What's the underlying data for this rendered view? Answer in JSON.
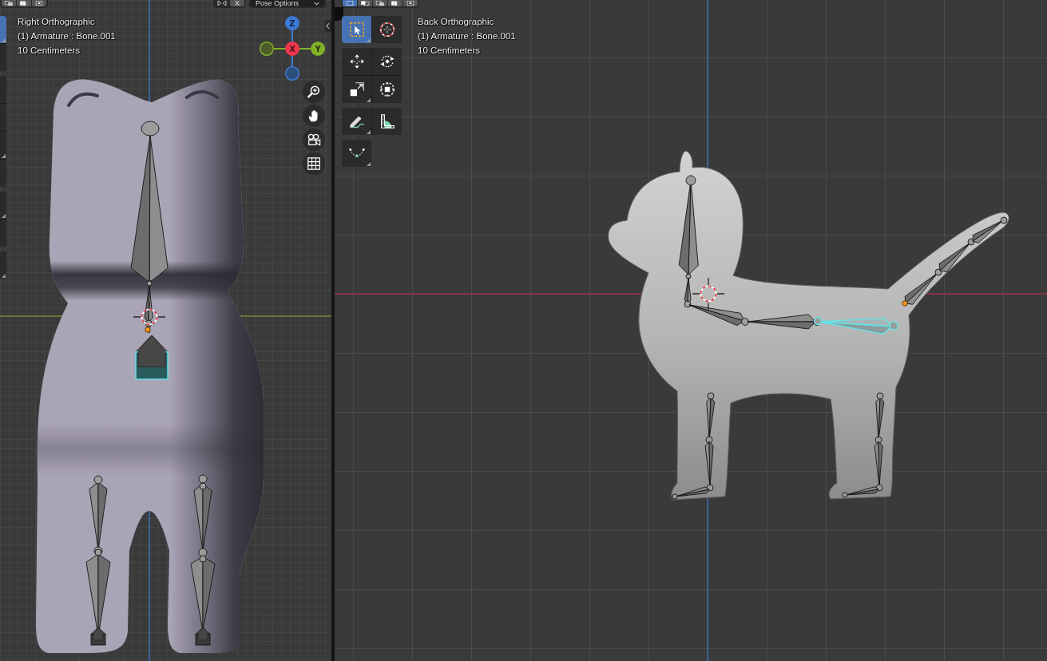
{
  "viewports": [
    {
      "header": {
        "select_modes": [
          {
            "kind": "subtract",
            "selected": false
          },
          {
            "kind": "difference",
            "selected": false
          },
          {
            "kind": "intersect",
            "selected": false
          }
        ],
        "symmetry": {
          "label": "X",
          "on": false
        },
        "options": "Pose Options"
      },
      "toolbar": {
        "groups": [
          [
            {
              "selected": true,
              "has_variants": true
            },
            {
              "selected": false,
              "has_variants": false
            }
          ],
          [
            {
              "selected": false,
              "has_variants": false
            },
            {
              "selected": false,
              "has_variants": false
            },
            {
              "selected": false,
              "has_variants": true
            },
            {
              "selected": false,
              "has_variants": false
            }
          ],
          [
            {
              "selected": false,
              "has_variants": true
            },
            {
              "selected": false,
              "has_variants": false
            }
          ],
          [
            {
              "selected": false,
              "has_variants": true
            }
          ]
        ]
      },
      "info": {
        "view": "Right Orthographic",
        "object": "(1) Armature : Bone.001",
        "scale": "10 Centimeters"
      },
      "gizmo": {
        "axes": [
          {
            "label": "Z"
          },
          {
            "label": "X"
          },
          {
            "label": "Y"
          }
        ]
      },
      "navigation": [
        {
          "kind": "zoom"
        },
        {
          "kind": "pan"
        },
        {
          "kind": "camera"
        },
        {
          "kind": "ortho"
        }
      ],
      "scene": {
        "kind": "front",
        "bones": [
          {
            "selected": false
          },
          {
            "selected": false
          },
          {
            "selected": true
          },
          {
            "selected": false
          },
          {
            "selected": false
          },
          {
            "selected": false
          },
          {
            "selected": false
          },
          {
            "selected": false
          },
          {
            "selected": false
          }
        ]
      }
    },
    {
      "header": {
        "select_modes": [
          {
            "kind": "new",
            "selected": true
          },
          {
            "kind": "extend",
            "selected": false
          },
          {
            "kind": "subtract",
            "selected": false
          },
          {
            "kind": "difference",
            "selected": false
          },
          {
            "kind": "intersect",
            "selected": false
          }
        ]
      },
      "toolbar": {
        "groups": [
          [
            {
              "kind": "select_box",
              "selected": true,
              "has_variants": true
            },
            {
              "kind": "cursor",
              "selected": false,
              "has_variants": false
            }
          ],
          [
            {
              "kind": "move",
              "selected": false,
              "has_variants": false
            },
            {
              "kind": "rotate",
              "selected": false,
              "has_variants": false
            },
            {
              "kind": "scale",
              "selected": false,
              "has_variants": true
            },
            {
              "kind": "transform",
              "selected": false,
              "has_variants": false
            }
          ],
          [
            {
              "kind": "annotate",
              "selected": false,
              "has_variants": true
            },
            {
              "kind": "measure",
              "selected": false,
              "has_variants": false
            }
          ],
          [
            {
              "kind": "bone_roll",
              "selected": false,
              "has_variants": true
            }
          ]
        ]
      },
      "info": {
        "view": "Back Orthographic",
        "object": "(1) Armature : Bone.001",
        "scale": "10 Centimeters"
      },
      "scene": {
        "kind": "side",
        "bones": [
          {
            "selected": false
          },
          {
            "selected": false
          },
          {
            "selected": false
          },
          {
            "selected": false
          },
          {
            "selected": true
          },
          {
            "selected": false
          },
          {
            "selected": false
          },
          {
            "selected": false
          },
          {
            "selected": false
          },
          {
            "selected": false
          },
          {
            "selected": false
          },
          {
            "selected": false
          },
          {
            "selected": false
          },
          {
            "selected": false
          }
        ]
      }
    }
  ]
}
